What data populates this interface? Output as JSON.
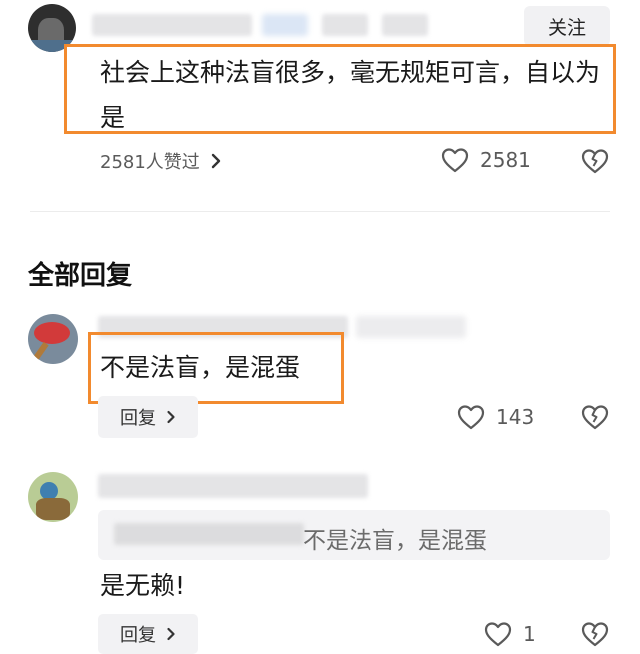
{
  "post": {
    "follow_label": "关注",
    "text": "社会上这种法盲很多，毫无规矩可言，自以为是",
    "likes_summary": "2581人赞过",
    "like_count": "2581"
  },
  "replies_section": {
    "title": "全部回复"
  },
  "replies": [
    {
      "text": "不是法盲，是混蛋",
      "reply_label": "回复",
      "like_count": "143"
    },
    {
      "quoted_text": "不是法盲，是混蛋",
      "text": "是无赖!",
      "reply_label": "回复",
      "like_count": "1"
    }
  ],
  "colors": {
    "highlight_box": "#f28a2e",
    "reply_background": "#f2f2f4"
  }
}
